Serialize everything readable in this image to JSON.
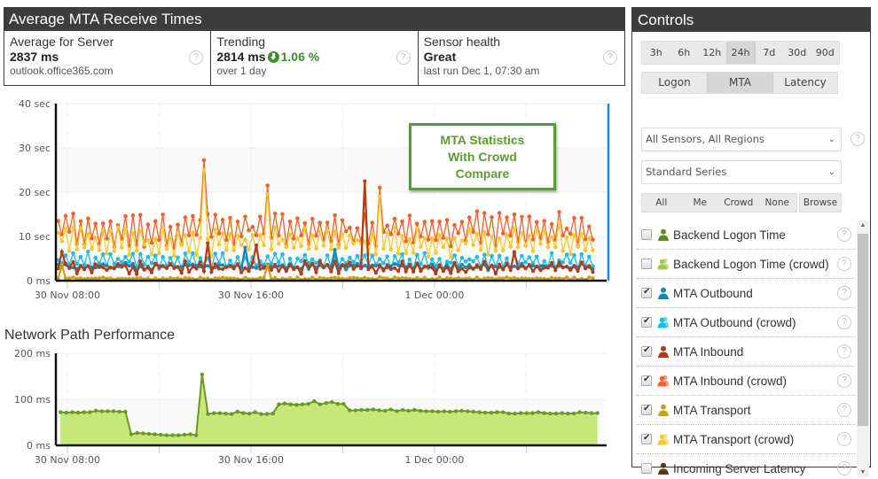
{
  "main_panel": {
    "title": "Average MTA Receive Times",
    "stats": [
      {
        "label": "Average for Server",
        "value": "2837 ms",
        "sub": "outlook.office365.com",
        "help": "?"
      },
      {
        "label": "Trending",
        "value": "2814 ms",
        "trend_icon": "arrow-down-circle-icon",
        "trend_value": "1.06 %",
        "sub": "over 1 day",
        "help": "?"
      },
      {
        "label": "Sensor health",
        "value": "Great",
        "sub": "last run Dec 1, 07:30 am",
        "help": "?"
      }
    ],
    "annotation": [
      "MTA Statistics",
      "With Crowd",
      "Compare"
    ]
  },
  "network_title": "Network Path Performance",
  "colors": {
    "accent_green": "#5c9c2e",
    "trend_green": "#3c8f2a",
    "header_dark": "#3d3d3d",
    "selection_blue": "#1a86e8"
  },
  "chart_data": [
    {
      "type": "line",
      "title": "Average MTA Receive Times",
      "ylabel": "",
      "xlabel": "",
      "ylim": [
        0,
        40
      ],
      "yunit": "sec",
      "yticks": [
        {
          "v": 0,
          "label": "0 ms"
        },
        {
          "v": 10,
          "label": "10 sec"
        },
        {
          "v": 20,
          "label": "20 sec"
        },
        {
          "v": 30,
          "label": "30 sec"
        },
        {
          "v": 40,
          "label": "40 sec"
        }
      ],
      "x_range_hours": [
        -0.5,
        23.5
      ],
      "xticks": [
        {
          "h": 0,
          "label": "30 Nov 08:00"
        },
        {
          "h": 4,
          "label": ""
        },
        {
          "h": 8,
          "label": "30 Nov 16:00"
        },
        {
          "h": 12,
          "label": ""
        },
        {
          "h": 16,
          "label": "1 Dec 00:00"
        },
        {
          "h": 20,
          "label": ""
        }
      ],
      "grid": true,
      "legend": "none",
      "points_per_series": 144,
      "series": [
        {
          "name": "MTA Inbound (crowd)",
          "color": "#f2622c",
          "mean": 11.5,
          "amp": 2.5,
          "noise": 1.5,
          "spikes": [
            [
              0.27,
              27.2
            ],
            [
              0.39,
              21.5
            ],
            [
              0.6,
              21
            ],
            [
              0.94,
              15.5
            ]
          ]
        },
        {
          "name": "MTA Transport (crowd)",
          "color": "#f7c931",
          "mean": 8.8,
          "amp": 2.0,
          "noise": 1.2,
          "spikes": [
            [
              0.27,
              25
            ],
            [
              0.39,
              19.5
            ],
            [
              0.6,
              19
            ],
            [
              0.94,
              13
            ]
          ]
        },
        {
          "name": "MTA Outbound (crowd)",
          "color": "#1cbde8",
          "mean": 4.5,
          "amp": 1.0,
          "noise": 0.8,
          "spikes": []
        },
        {
          "name": "MTA Outbound",
          "color": "#1687b0",
          "mean": 3.2,
          "amp": 0.3,
          "noise": 0.5,
          "spikes": [
            [
              0.35,
              7.5
            ],
            [
              0.52,
              7
            ]
          ]
        },
        {
          "name": "MTA Inbound",
          "color": "#b53a14",
          "mean": 3.0,
          "amp": 0.6,
          "noise": 0.8,
          "spikes": [
            [
              0.01,
              6.5
            ],
            [
              0.28,
              8.5
            ],
            [
              0.37,
              8
            ],
            [
              0.57,
              22.5
            ],
            [
              0.85,
              6.5
            ]
          ]
        },
        {
          "name": "MTA Transport",
          "color": "#c9a114",
          "mean": 0.5,
          "amp": 0.1,
          "noise": 0.2,
          "spikes": [
            [
              0.01,
              3.5
            ],
            [
              0.39,
              3.5
            ]
          ]
        }
      ]
    },
    {
      "type": "area",
      "title": "Network Path Performance",
      "ylim": [
        0,
        200
      ],
      "yunit": "ms",
      "yticks": [
        {
          "v": 0,
          "label": "0 ms"
        },
        {
          "v": 100,
          "label": "100 ms"
        },
        {
          "v": 200,
          "label": "200 ms"
        }
      ],
      "x_range_hours": [
        -0.5,
        23.5
      ],
      "xticks": [
        {
          "h": 0,
          "label": "30 Nov 08:00"
        },
        {
          "h": 4,
          "label": ""
        },
        {
          "h": 8,
          "label": "30 Nov 16:00"
        },
        {
          "h": 12,
          "label": ""
        },
        {
          "h": 16,
          "label": "1 Dec 00:00"
        },
        {
          "h": 20,
          "label": ""
        }
      ],
      "grid": true,
      "series": [
        {
          "name": "Network Path",
          "color": "#6b9a22",
          "fill": "#c5e878",
          "x_hours": [
            -0.3,
            0.0,
            0.3,
            0.6,
            0.9,
            1.2,
            1.5,
            1.8,
            2.1,
            2.4,
            2.7,
            3.0,
            3.3,
            3.6,
            3.9,
            4.2,
            4.5,
            4.8,
            5.1,
            5.4,
            5.7,
            6.0,
            6.3,
            6.6,
            6.9,
            7.2,
            7.5,
            7.8,
            8.1,
            8.4,
            8.7,
            9.0,
            9.3,
            9.6,
            9.9,
            10.2,
            10.5,
            10.8,
            11.1,
            11.4,
            11.7,
            12.0,
            12.3,
            12.6,
            12.9,
            13.2,
            13.5,
            13.8,
            14.1,
            14.4,
            14.7,
            15.0,
            15.3,
            15.6,
            15.9,
            16.2,
            16.5,
            16.8,
            17.1,
            17.4,
            17.7,
            18.0,
            18.3,
            18.6,
            18.9,
            19.2,
            19.5,
            19.8,
            20.1,
            20.4,
            20.7,
            21.0,
            21.3,
            21.6,
            21.9,
            22.2,
            22.5,
            22.8,
            23.1
          ],
          "values_ms": [
            72,
            71,
            72,
            71,
            72,
            72,
            75,
            74,
            74,
            74,
            73,
            73,
            24,
            27,
            26,
            25,
            24,
            23,
            22,
            22,
            22,
            23,
            24,
            22,
            154,
            68,
            70,
            70,
            69,
            68,
            73,
            70,
            69,
            72,
            68,
            68,
            69,
            89,
            91,
            89,
            88,
            89,
            90,
            96,
            89,
            92,
            94,
            90,
            90,
            76,
            76,
            77,
            77,
            78,
            76,
            75,
            78,
            74,
            77,
            75,
            77,
            75,
            74,
            74,
            73,
            74,
            73,
            74,
            75,
            74,
            73,
            72,
            71,
            71,
            72,
            72,
            69,
            69,
            70,
            70,
            70,
            72,
            70,
            69,
            69,
            70,
            69,
            69,
            72,
            71,
            70,
            70
          ]
        }
      ]
    }
  ],
  "controls": {
    "title": "Controls",
    "ranges": [
      "3h",
      "6h",
      "12h",
      "24h",
      "7d",
      "30d",
      "90d"
    ],
    "active_range": "24h",
    "categories": [
      "Logon",
      "MTA",
      "Latency"
    ],
    "active_category": "MTA",
    "sensor_select": "All Sensors, All Regions",
    "series_select": "Standard Series",
    "filters": [
      "All",
      "Me",
      "Crowd",
      "None"
    ],
    "browse_label": "Browse",
    "series": [
      {
        "label": "Backend Logon Time",
        "checked": false,
        "icon": "person-icon",
        "crowd": false,
        "color": "#5e8c1f"
      },
      {
        "label": "Backend Logon Time (crowd)",
        "checked": false,
        "icon": "people-icon",
        "crowd": true,
        "color": "#9ccc4a"
      },
      {
        "label": "MTA Outbound",
        "checked": true,
        "icon": "person-icon",
        "crowd": false,
        "color": "#1687b0"
      },
      {
        "label": "MTA Outbound (crowd)",
        "checked": true,
        "icon": "people-icon",
        "crowd": true,
        "color": "#1cbde8"
      },
      {
        "label": "MTA Inbound",
        "checked": true,
        "icon": "person-icon",
        "crowd": false,
        "color": "#b53a14"
      },
      {
        "label": "MTA Inbound (crowd)",
        "checked": true,
        "icon": "people-icon",
        "crowd": true,
        "color": "#f2622c"
      },
      {
        "label": "MTA Transport",
        "checked": true,
        "icon": "person-icon",
        "crowd": false,
        "color": "#c9a114"
      },
      {
        "label": "MTA Transport (crowd)",
        "checked": true,
        "icon": "people-icon",
        "crowd": true,
        "color": "#f7c931"
      },
      {
        "label": "Incoming Server Latency",
        "checked": false,
        "icon": "person-icon",
        "crowd": false,
        "color": "#5a3a0c"
      }
    ],
    "help": "?"
  }
}
